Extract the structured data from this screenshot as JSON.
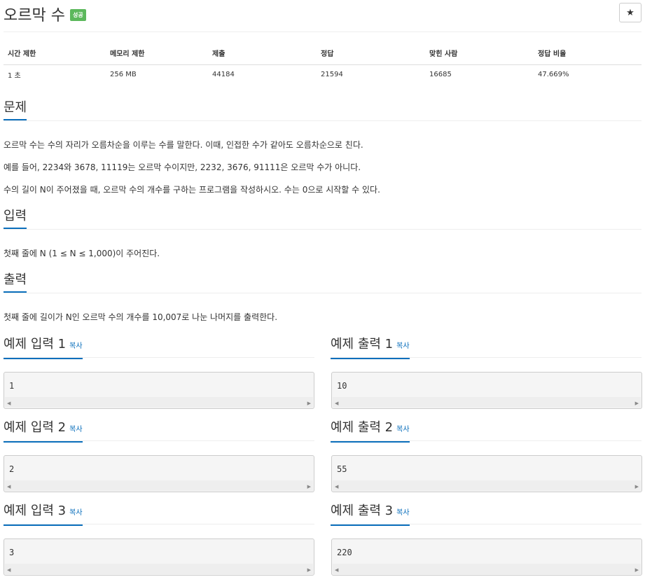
{
  "problem": {
    "title": "오르막 수",
    "badge": "성공",
    "star_icon": "★"
  },
  "info_table": {
    "headers": [
      "시간 제한",
      "메모리 제한",
      "제출",
      "정답",
      "맞힌 사람",
      "정답 비율"
    ],
    "values": [
      "1 초",
      "256 MB",
      "44184",
      "21594",
      "16685",
      "47.669%"
    ]
  },
  "sections": {
    "problem": {
      "title": "문제",
      "paragraphs": [
        "오르막 수는 수의 자리가 오름차순을 이루는 수를 말한다. 이때, 인접한 수가 같아도 오름차순으로 친다.",
        "예를 들어, 2234와 3678, 11119는 오르막 수이지만, 2232, 3676, 91111은 오르막 수가 아니다.",
        "수의 길이 N이 주어졌을 때, 오르막 수의 개수를 구하는 프로그램을 작성하시오. 수는 0으로 시작할 수 있다."
      ]
    },
    "input": {
      "title": "입력",
      "text": "첫째 줄에 N (1 ≤ N ≤ 1,000)이 주어진다."
    },
    "output": {
      "title": "출력",
      "text": "첫째 줄에 길이가 N인 오르막 수의 개수를 10,007로 나눈 나머지를 출력한다."
    }
  },
  "samples": [
    {
      "input_title": "예제 입력 1",
      "output_title": "예제 출력 1",
      "copy_label": "복사",
      "input": "1",
      "output": "10"
    },
    {
      "input_title": "예제 입력 2",
      "output_title": "예제 출력 2",
      "copy_label": "복사",
      "input": "2",
      "output": "55"
    },
    {
      "input_title": "예제 입력 3",
      "output_title": "예제 출력 3",
      "copy_label": "복사",
      "input": "3",
      "output": "220"
    }
  ],
  "colors": {
    "accent": "#0b6fbc",
    "success": "#5cb85c"
  }
}
